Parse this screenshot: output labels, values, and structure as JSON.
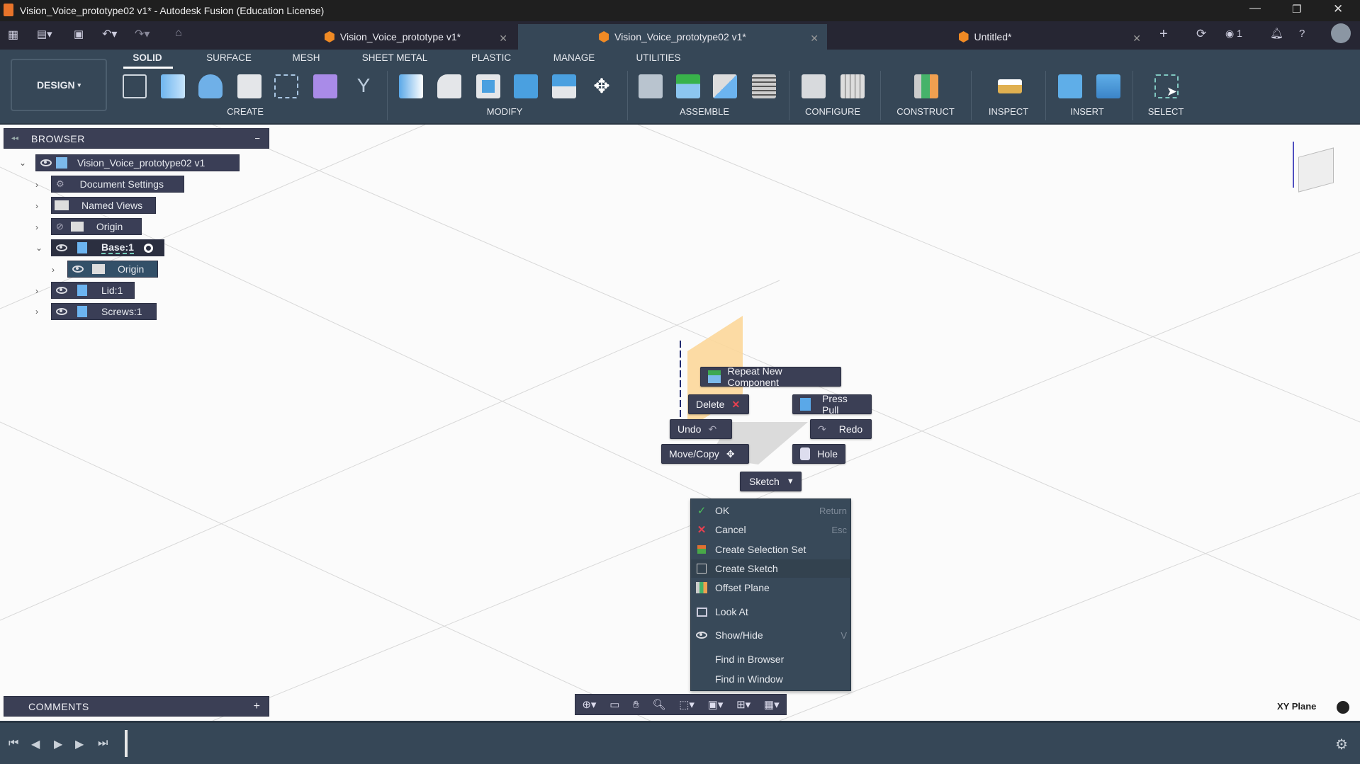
{
  "window": {
    "title": "Vision_Voice_prototype02 v1* - Autodesk Fusion (Education License)"
  },
  "tabs": [
    {
      "label": "Vision_Voice_prototype v1*"
    },
    {
      "label": "Vision_Voice_prototype02 v1*"
    },
    {
      "label": "Untitled*"
    }
  ],
  "notifications_count": "1",
  "workspace": "DESIGN",
  "ribbon_tabs": [
    "SOLID",
    "SURFACE",
    "MESH",
    "SHEET METAL",
    "PLASTIC",
    "MANAGE",
    "UTILITIES"
  ],
  "groups": [
    "CREATE",
    "MODIFY",
    "ASSEMBLE",
    "CONFIGURE",
    "CONSTRUCT",
    "INSPECT",
    "INSERT",
    "SELECT"
  ],
  "browser": {
    "title": "BROWSER",
    "items": [
      "Vision_Voice_prototype02 v1",
      "Document Settings",
      "Named Views",
      "Origin",
      "Base:1",
      "Origin",
      "Lid:1",
      "Screws:1"
    ]
  },
  "comments": {
    "title": "COMMENTS"
  },
  "marking_menu": {
    "repeat": "Repeat New Component",
    "delete": "Delete",
    "press_pull": "Press Pull",
    "undo": "Undo",
    "redo": "Redo",
    "move_copy": "Move/Copy",
    "hole": "Hole",
    "sketch": "Sketch"
  },
  "context_menu": [
    {
      "label": "OK",
      "shortcut": "Return"
    },
    {
      "label": "Cancel",
      "shortcut": "Esc"
    },
    {
      "label": "Create Selection Set",
      "shortcut": ""
    },
    {
      "label": "Create Sketch",
      "shortcut": ""
    },
    {
      "label": "Offset Plane",
      "shortcut": ""
    },
    {
      "label": "Look At",
      "shortcut": ""
    },
    {
      "label": "Show/Hide",
      "shortcut": "V"
    },
    {
      "label": "Find in Browser",
      "shortcut": ""
    },
    {
      "label": "Find in Window",
      "shortcut": ""
    }
  ],
  "status": {
    "plane": "XY Plane"
  },
  "colors": {
    "toolbar": "#364757",
    "panel": "#3a3e56",
    "accent": "#f08a24"
  }
}
